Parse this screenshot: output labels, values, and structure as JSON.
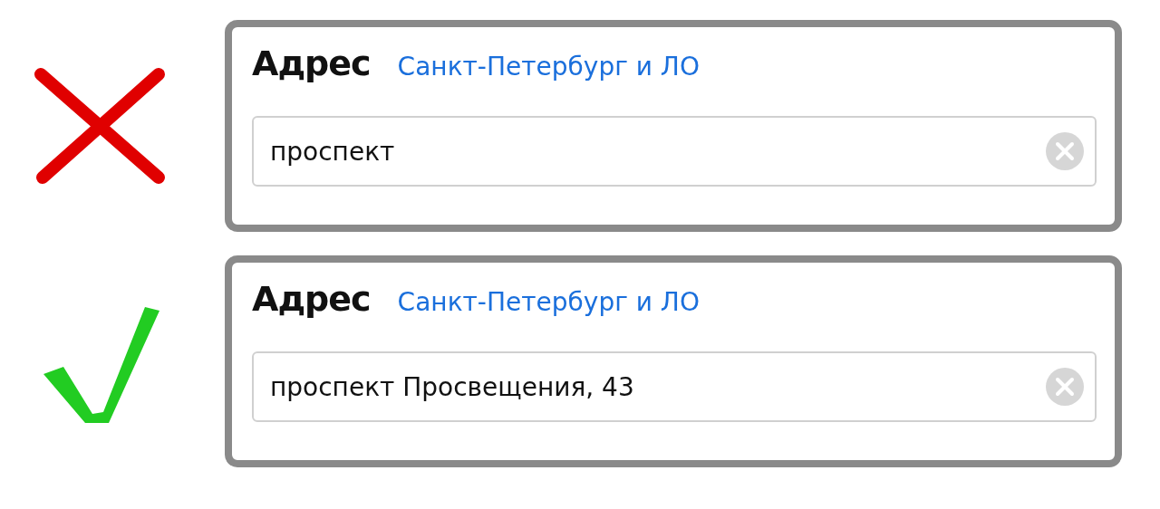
{
  "examples": [
    {
      "kind": "wrong",
      "title": "Адрес",
      "region": "Санкт-Петербург и ЛО",
      "input": {
        "value": "проспект"
      }
    },
    {
      "kind": "right",
      "title": "Адрес",
      "region": "Санкт-Петербург и ЛО",
      "input": {
        "value": "проспект Просвещения, 43"
      }
    }
  ]
}
